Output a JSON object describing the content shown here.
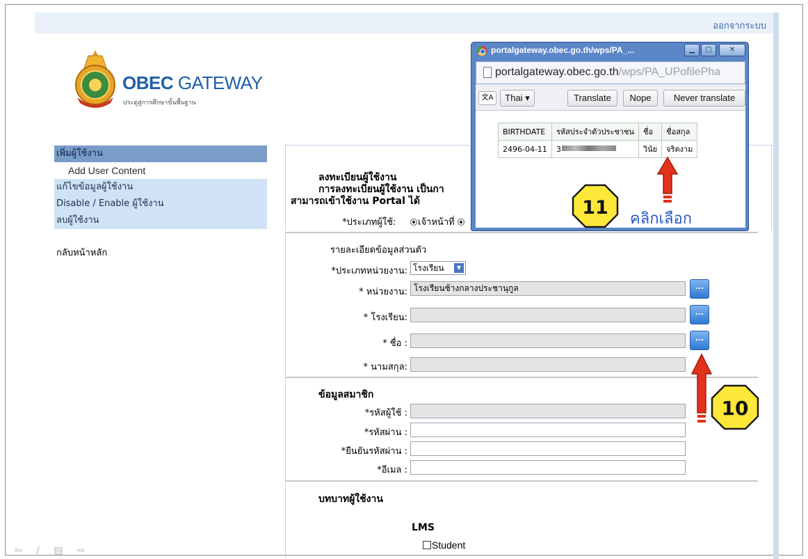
{
  "header": {
    "logout": "ออกจากระบบ"
  },
  "logo": {
    "title_bold": "OBEC",
    "title_light": "GATEWAY",
    "subtitle": "ประตูสู่การศึกษาขั้นพื้นฐาน"
  },
  "sidebar": {
    "items": [
      {
        "label": "เพิ่มผู้ใช้งาน"
      },
      {
        "label": "Add User Content"
      },
      {
        "label": "แก้ไขข้อมูลผู้ใช้งาน"
      },
      {
        "label": "Disable / Enable ผู้ใช้งาน"
      },
      {
        "label": "ลบผู้ใช้งาน"
      }
    ],
    "back": "กลับหน้าหลัก"
  },
  "form": {
    "title": "ลงทะเบียนผู้ใช้งาน",
    "desc_line1": "การลงทะเบียนผู้ใช้งาน เป็นกา",
    "desc_line2": "สามารถเข้าใช้งาน Portal ได้",
    "user_type_label": "*ประเภทผู้ใช้:",
    "user_type_value": "เจ้าหน้าที่",
    "personal_section": "รายละเอียดข้อมูลส่วนตัว",
    "unit_type_label": "*ประเภทหน่วยงาน:",
    "unit_type_value": "โรงเรียน",
    "unit_label": "* หน่วยงาน:",
    "unit_value": "โรงเรียนช้างกลางประชานุกูล",
    "school_label": "* โรงเรียน:",
    "school_value": "",
    "name_label": "* ชื่อ :",
    "name_value": "",
    "surname_label": "* นามสกุล:",
    "surname_value": "",
    "lookup_button": "...",
    "member_section": "ข้อมูลสมาชิก",
    "username_label": "*รหัสผู้ใช้ :",
    "password_label": "*รหัสผ่าน :",
    "confirm_label": "*ยืนยันรหัสผ่าน :",
    "email_label": "*อีเมล :",
    "role_section": "บทบาทผู้ใช้งาน",
    "lms_label": "LMS",
    "student_label": "Student"
  },
  "popup": {
    "title": "portalgateway.obec.go.th/wps/PA_...",
    "url_host": "portalgateway.obec.go.th",
    "url_path": "/wps/PA_UPofilePha",
    "language": "Thai",
    "translate": "Translate",
    "nope": "Nope",
    "never_translate": "Never translate",
    "table": {
      "headers": [
        "BIRTHDATE",
        "รหัสประจำตัวประชาชน",
        "ชื่อ",
        "ชื่อสกุล"
      ],
      "row": [
        "2496-04-11",
        "3",
        "วินัย",
        "จริตงาม"
      ]
    }
  },
  "annotations": {
    "step10": "10",
    "step11": "11",
    "click_select": "คลิกเลือก",
    "arrow_color": "#e0321c",
    "badge_color": "#fde83a"
  }
}
